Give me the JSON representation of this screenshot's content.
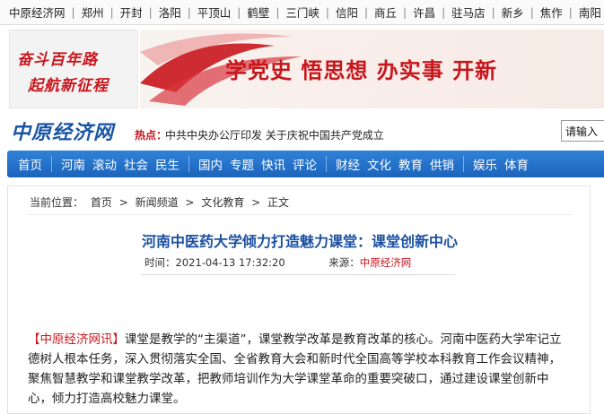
{
  "citybar": {
    "items": [
      "中原经济网",
      "郑州",
      "开封",
      "洛阳",
      "平顶山",
      "鹤壁",
      "三门峡",
      "信阳",
      "商丘",
      "许昌",
      "驻马店",
      "新乡",
      "焦作",
      "南阳"
    ],
    "separator": "|"
  },
  "banner": {
    "left_line1": "奋斗百年路",
    "left_line2": "起航新征程",
    "slogan": "学党史  悟思想  办实事  开新"
  },
  "header": {
    "logo": "中原经济网",
    "hot_label": "热点：",
    "hot_text": "中共中央办公厅印发 关于庆祝中国共产党成立",
    "search_placeholder": "请输入"
  },
  "nav": {
    "items": [
      "首页",
      "河南",
      "滚动",
      "社会",
      "民生",
      "国内",
      "专题",
      "快讯",
      "评论",
      "财经",
      "文化",
      "教育",
      "供销",
      "娱乐",
      "体育"
    ]
  },
  "breadcrumb": {
    "label": "当前位置：",
    "items": [
      "首页",
      "新闻频道",
      "文化教育",
      "正文"
    ],
    "sep": ">"
  },
  "article": {
    "title": "河南中医药大学倾力打造魅力课堂：课堂创新中心",
    "time_label": "时间：",
    "time": "2021-04-13 17:32:20",
    "source_label": "来源：",
    "source": "中原经济网",
    "lead_tag": "【中原经济网讯】",
    "body": "课堂是教学的“主渠道”，课堂教学改革是教育改革的核心。河南中医药大学牢记立德树人根本任务，深入贯彻落实全国、全省教育大会和新时代全国高等学校本科教育工作会议精神，聚焦智慧教学和课堂教学改革，把教师培训作为大学课堂革命的重要突破口，通过建设课堂创新中心，倾力打造高校魅力课堂。"
  },
  "colors": {
    "brand_red": "#c8161d",
    "nav_blue": "#1c64bc",
    "title_blue": "#1a4fa0"
  }
}
